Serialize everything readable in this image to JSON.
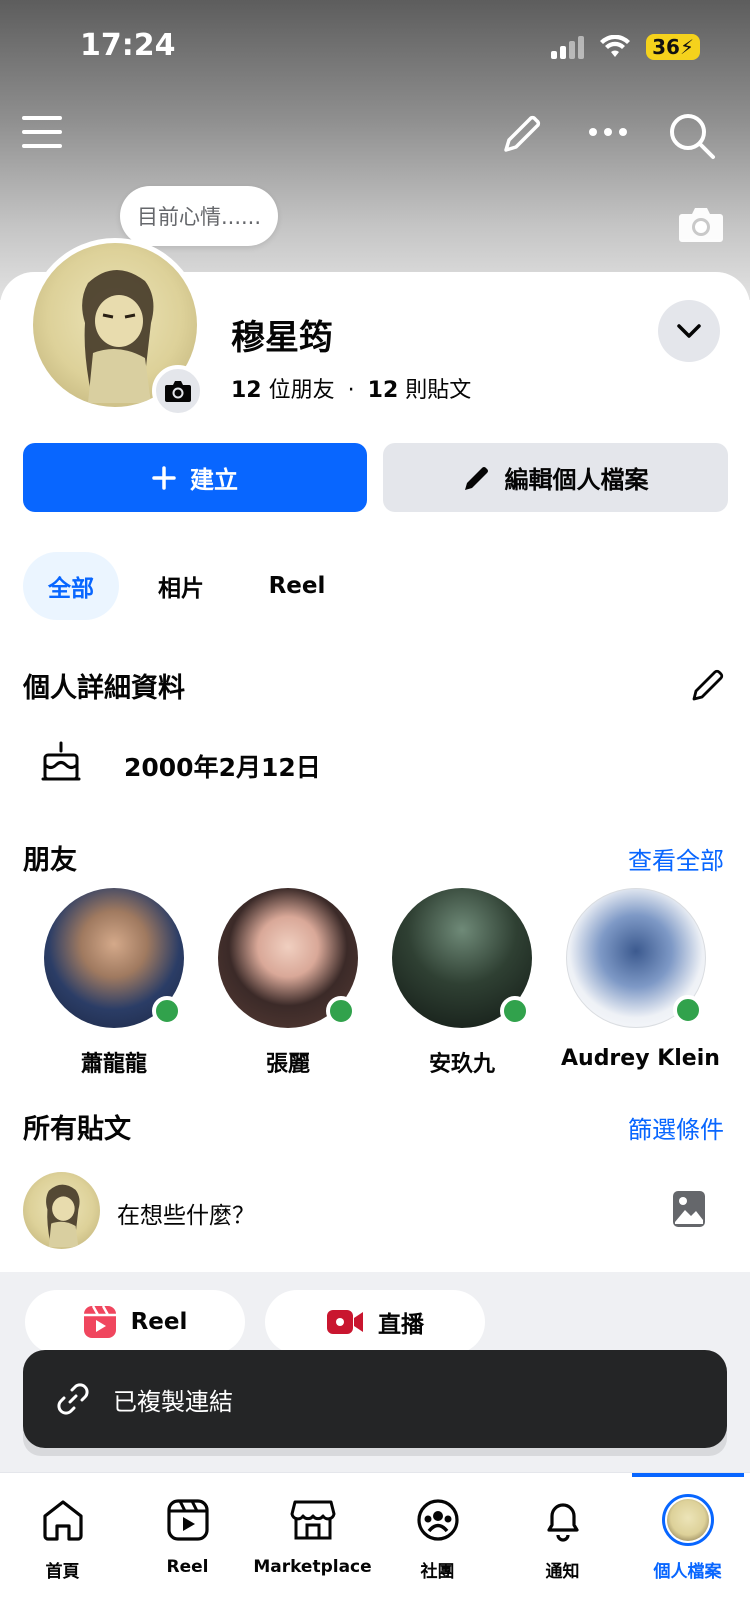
{
  "status_bar": {
    "time": "17:24",
    "battery": "36"
  },
  "mood_bubble": "目前心情......",
  "profile": {
    "name": "穆星筠",
    "friends_count": "12",
    "friends_label": "位朋友",
    "separator": "·",
    "posts_count": "12",
    "posts_label": "則貼文"
  },
  "buttons": {
    "create": "建立",
    "edit": "編輯個人檔案"
  },
  "tabs": [
    "全部",
    "相片",
    "Reel"
  ],
  "details": {
    "title": "個人詳細資料",
    "birthday": "2000年2月12日"
  },
  "friends": {
    "title": "朋友",
    "see_all": "查看全部",
    "items": [
      {
        "name": "蕭龍龍",
        "color": "#3b4f7a"
      },
      {
        "name": "張麗",
        "color": "#6b4a3c"
      },
      {
        "name": "安玖九",
        "color": "#1f2b22"
      },
      {
        "name": "Audrey Klein",
        "color": "#dfe6ef"
      }
    ]
  },
  "posts": {
    "title": "所有貼文",
    "filter": "篩選條件",
    "composer_placeholder": "在想些什麼？"
  },
  "quick_actions": {
    "reel": "Reel",
    "live": "直播"
  },
  "toast": {
    "text": "已複製連結"
  },
  "bottom_nav": [
    "首頁",
    "Reel",
    "Marketplace",
    "社團",
    "通知",
    "個人檔案"
  ],
  "colors": {
    "accent": "#0866ff",
    "online": "#31a24c",
    "toast_bg": "#242526"
  }
}
